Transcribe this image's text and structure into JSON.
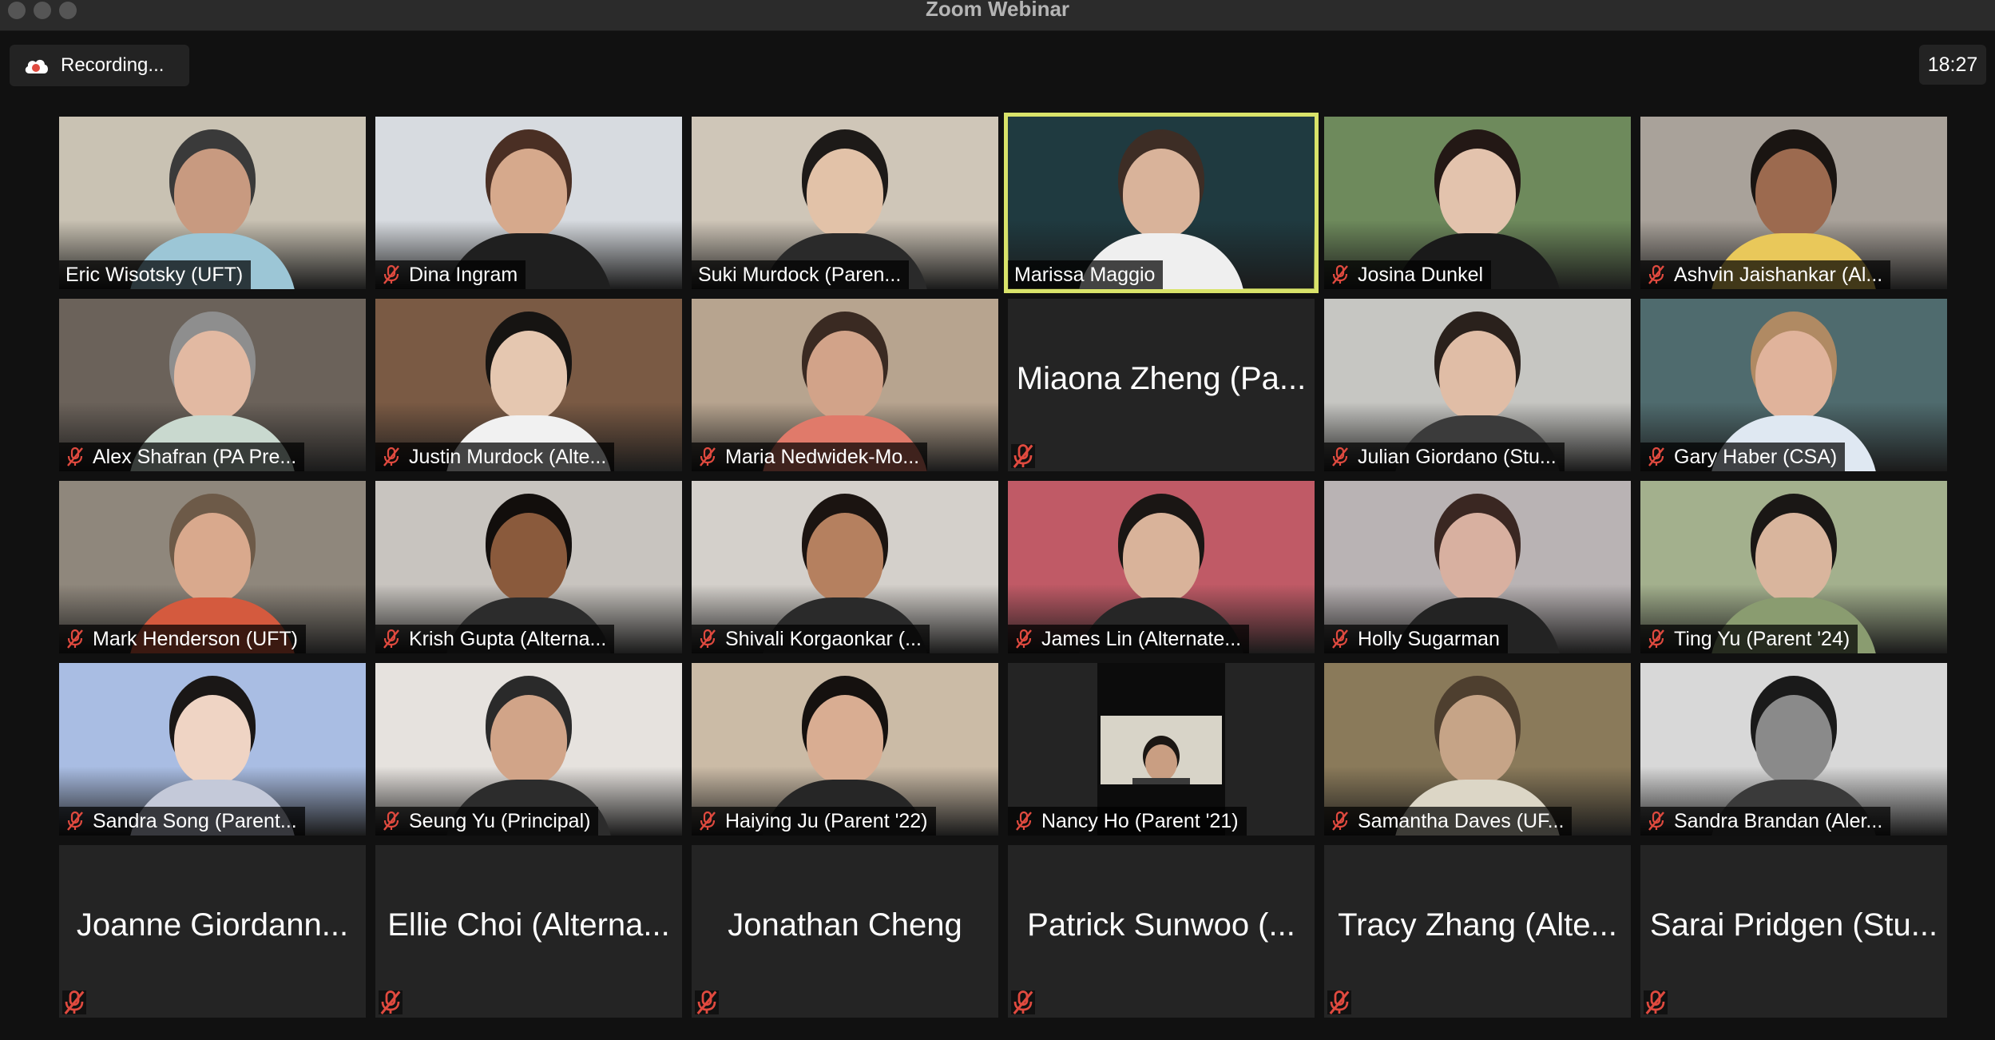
{
  "window": {
    "title": "Zoom Webinar"
  },
  "recording": {
    "label": "Recording..."
  },
  "clock": {
    "time": "18:27"
  },
  "colors": {
    "active_speaker_border": "#d9e36a",
    "mute_icon": "#e04a3f",
    "recording_icon": "#e04a3f"
  },
  "participants": [
    {
      "name": "Eric Wisotsky (UFT)",
      "video": true,
      "muted": false,
      "bg": "#c9c2b3",
      "skin": "#c89a80",
      "shirt": "#9cc6d6",
      "hair": "#3a3a3a"
    },
    {
      "name": "Dina Ingram",
      "video": true,
      "muted": true,
      "bg": "#d7dbe0",
      "skin": "#d6a98c",
      "shirt": "#1f1f1f",
      "hair": "#4a2f24"
    },
    {
      "name": "Suki Murdock (Paren...",
      "video": true,
      "muted": false,
      "bg": "#cfc6b8",
      "skin": "#e2c2a8",
      "shirt": "#2a2a2a",
      "hair": "#1d1a18"
    },
    {
      "name": "Marissa Maggio",
      "video": true,
      "muted": false,
      "active": true,
      "bg": "#1f3a40",
      "skin": "#d9b39a",
      "shirt": "#efefef",
      "hair": "#3d2d25"
    },
    {
      "name": "Josina Dunkel",
      "video": true,
      "muted": true,
      "bg": "#6e8a5c",
      "skin": "#e3c3ad",
      "shirt": "#1a1a1a",
      "hair": "#231815"
    },
    {
      "name": "Ashvin Jaishankar (Al...",
      "video": true,
      "muted": true,
      "bg": "#a9a29a",
      "skin": "#9c6a4f",
      "shirt": "#e9c85a",
      "hair": "#1a1512"
    },
    {
      "name": "Alex Shafran (PA Pre...",
      "video": true,
      "muted": true,
      "bg": "#6b625a",
      "skin": "#e2b9a2",
      "shirt": "#c9d9cf",
      "hair": "#8e8e8e"
    },
    {
      "name": "Justin Murdock (Alte...",
      "video": true,
      "muted": true,
      "bg": "#7a5a44",
      "skin": "#e5c7b0",
      "shirt": "#f1f1f1",
      "hair": "#161412"
    },
    {
      "name": "Maria Nedwidek-Mo...",
      "video": true,
      "muted": true,
      "bg": "#b7a48f",
      "skin": "#d2a389",
      "shirt": "#e07a6a",
      "hair": "#3a2a22"
    },
    {
      "name": "Miaona Zheng (Pa...",
      "video": false,
      "muted": true
    },
    {
      "name": "Julian Giordano (Stu...",
      "video": true,
      "muted": true,
      "bg": "#c6c6c2",
      "skin": "#e0bda6",
      "shirt": "#3b3b3b",
      "hair": "#2a211c"
    },
    {
      "name": "Gary Haber (CSA)",
      "video": true,
      "muted": true,
      "bg": "#4f6b6e",
      "skin": "#e0b39b",
      "shirt": "#dfe8f2",
      "hair": "#b08a63"
    },
    {
      "name": "Mark Henderson (UFT)",
      "video": true,
      "muted": true,
      "bg": "#8f877c",
      "skin": "#d9a98d",
      "shirt": "#d45a3e",
      "hair": "#6d5a48"
    },
    {
      "name": "Krish Gupta (Alterna...",
      "video": true,
      "muted": true,
      "bg": "#c8c4bf",
      "skin": "#8a5a3c",
      "shirt": "#2c2c2c",
      "hair": "#120e0c"
    },
    {
      "name": "Shivali Korgaonkar (...",
      "video": true,
      "muted": true,
      "bg": "#d4d0cb",
      "skin": "#b5805f",
      "shirt": "#2a2a2a",
      "hair": "#1b1411"
    },
    {
      "name": "James Lin (Alternate...",
      "video": true,
      "muted": true,
      "bg": "#c05a66",
      "skin": "#d9b39a",
      "shirt": "#262626",
      "hair": "#1a1614"
    },
    {
      "name": "Holly Sugarman",
      "video": true,
      "muted": true,
      "bg": "#b9b3b4",
      "skin": "#d8b0a0",
      "shirt": "#232323",
      "hair": "#3a2722"
    },
    {
      "name": "Ting Yu (Parent '24)",
      "video": true,
      "muted": true,
      "bg": "#a3b08d",
      "skin": "#d9b59d",
      "shirt": "#8a9c70",
      "hair": "#1a1715"
    },
    {
      "name": "Sandra Song (Parent...",
      "video": true,
      "muted": true,
      "bg": "#a9bde3",
      "skin": "#efd4c4",
      "shirt": "#c4c9d9",
      "hair": "#1a1716"
    },
    {
      "name": "Seung Yu (Principal)",
      "video": true,
      "muted": true,
      "bg": "#e6e2de",
      "skin": "#d1a488",
      "shirt": "#2c2c2c",
      "hair": "#2a2a2a"
    },
    {
      "name": "Haiying Ju (Parent '22)",
      "video": true,
      "muted": true,
      "bg": "#cbbba6",
      "skin": "#d9ad92",
      "shirt": "#262626",
      "hair": "#15110f"
    },
    {
      "name": "Nancy Ho (Parent '21)",
      "video": true,
      "muted": true,
      "inset": true
    },
    {
      "name": "Samantha Daves (UF...",
      "video": true,
      "muted": true,
      "bg": "#8a7a5a",
      "skin": "#c6a487",
      "shirt": "#dcd6c6",
      "hair": "#4e3f2f"
    },
    {
      "name": "Sandra Brandan (Aler...",
      "video": true,
      "muted": true,
      "bg": "#d8d8d8",
      "skin": "#8a8a8a",
      "shirt": "#3a3a3a",
      "hair": "#1a1a1a",
      "bw": true
    },
    {
      "name": "Joanne Giordann...",
      "video": false,
      "muted": true
    },
    {
      "name": "Ellie Choi (Alterna...",
      "video": false,
      "muted": true
    },
    {
      "name": "Jonathan Cheng",
      "video": false,
      "muted": true
    },
    {
      "name": "Patrick Sunwoo (...",
      "video": false,
      "muted": true
    },
    {
      "name": "Tracy Zhang (Alte...",
      "video": false,
      "muted": true
    },
    {
      "name": "Sarai Pridgen (Stu...",
      "video": false,
      "muted": true
    }
  ]
}
